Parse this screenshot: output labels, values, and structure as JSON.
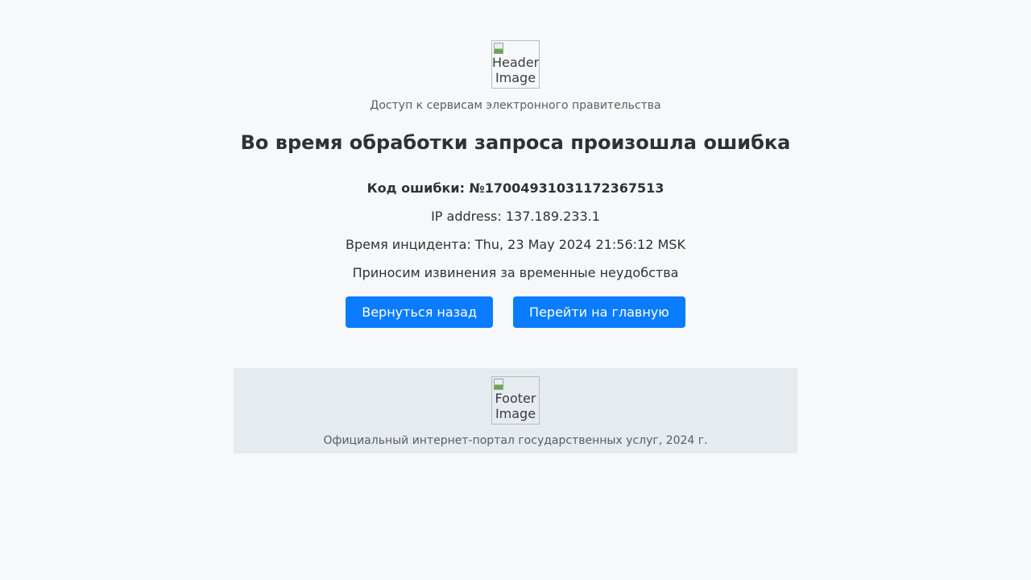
{
  "header": {
    "image_alt": "Header Image",
    "subtitle": "Доступ к сервисам электронного правительства"
  },
  "main": {
    "title": "Во время обработки запроса произошла ошибка",
    "error_code": "Код ошибки: №17004931031172367513",
    "ip_address": "IP address: 137.189.233.1",
    "incident_time": "Время инцидента: Thu, 23 May 2024 21:56:12 MSK",
    "apology": "Приносим извинения за временные неудобства",
    "buttons": {
      "back_label": "Вернуться назад",
      "home_label": "Перейти на главную"
    }
  },
  "footer": {
    "image_alt": "Footer Image",
    "text": "Официальный интернет-портал государственных услуг, 2024 г."
  },
  "colors": {
    "background": "#f6f8fa",
    "button": "#0a7cff",
    "footer_background": "#e5ebee"
  }
}
